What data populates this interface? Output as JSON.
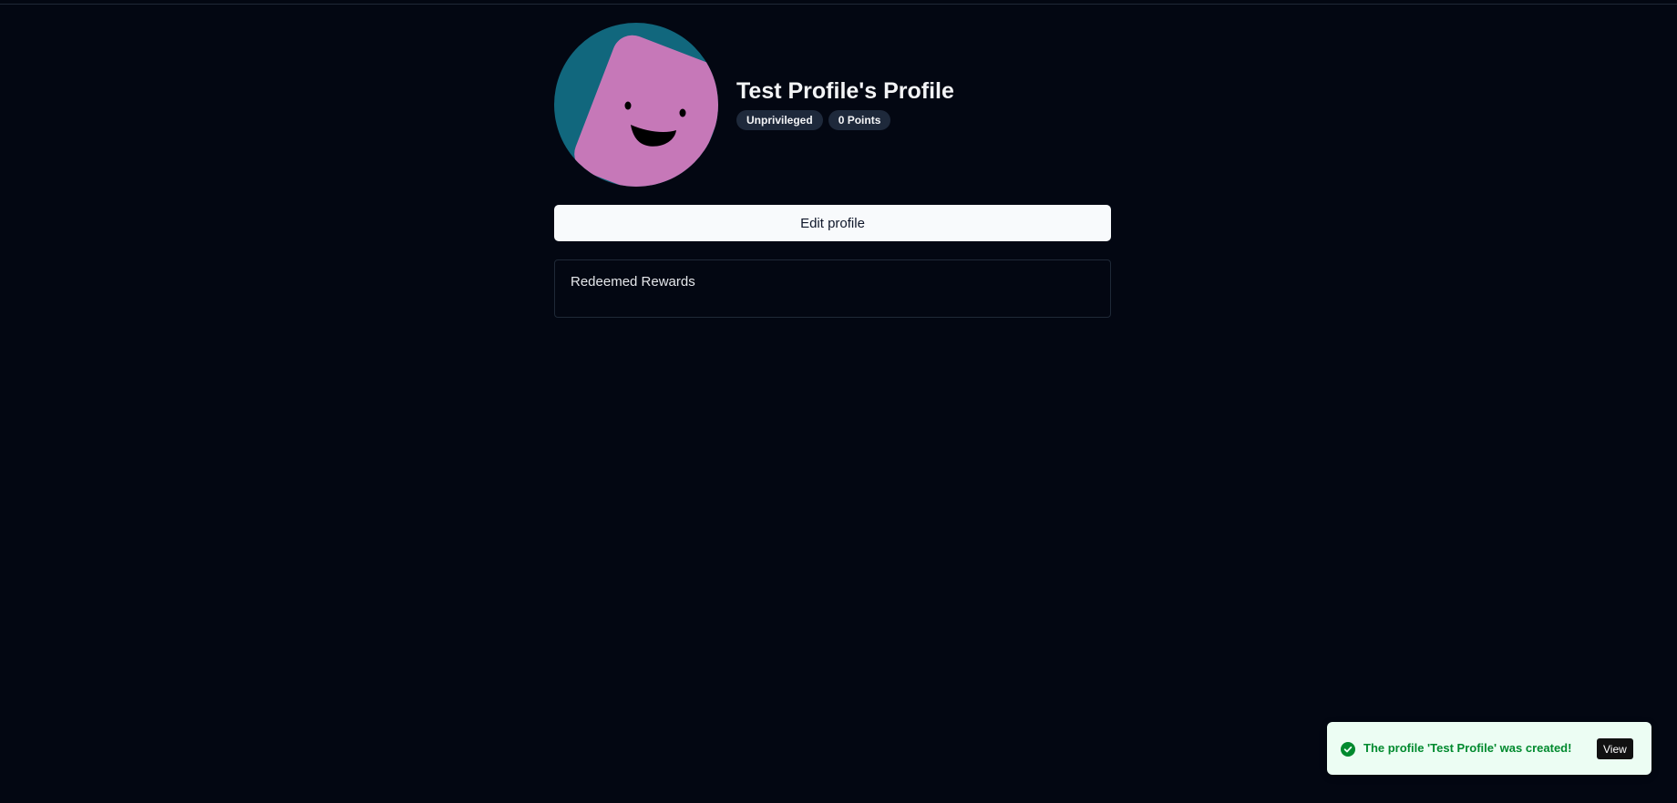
{
  "profile": {
    "title": "Test Profile's Profile",
    "role_badge": "Unprivileged",
    "points_badge": "0 Points",
    "avatar": {
      "icon": "smiling-square-face-avatar",
      "colors": {
        "background": "#11677d",
        "face": "#c678b8",
        "features": "#000000"
      }
    }
  },
  "actions": {
    "edit_label": "Edit profile"
  },
  "rewards": {
    "title": "Redeemed Rewards"
  },
  "toast": {
    "message": "The profile 'Test Profile' was created!",
    "action_label": "View",
    "icon": "check-circle-icon",
    "colors": {
      "background": "#ecfdf3",
      "text": "#008a2e"
    }
  }
}
